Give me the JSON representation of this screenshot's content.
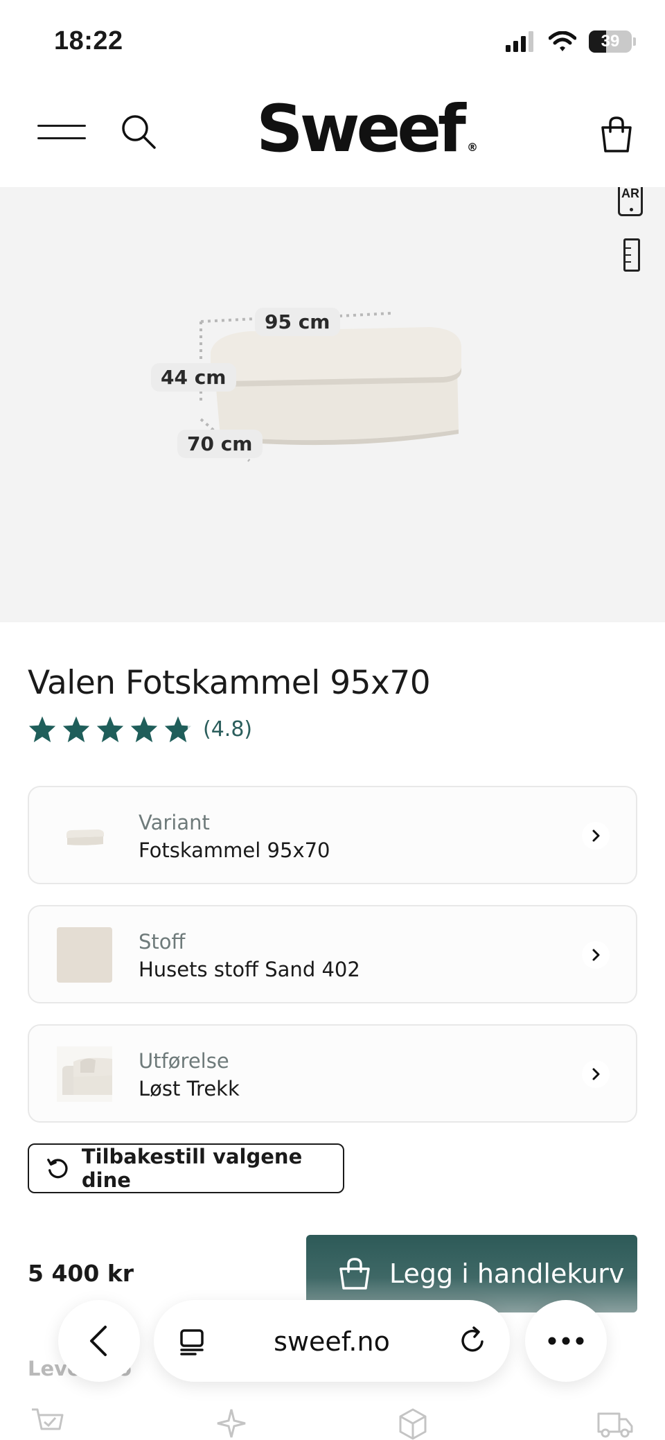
{
  "status_bar": {
    "time": "18:22",
    "battery": "39"
  },
  "header": {
    "logo": "Sweef",
    "logo_mark": "®"
  },
  "gallery": {
    "ar_label": "AR",
    "dimensions": {
      "width": "95 cm",
      "height": "44 cm",
      "depth": "70 cm"
    }
  },
  "product": {
    "title": "Valen Fotskammel 95x70",
    "rating": {
      "stars": 4.8,
      "label": "(4.8)"
    },
    "options": [
      {
        "label": "Variant",
        "value": "Fotskammel 95x70",
        "thumb": "ottoman-thumbnail"
      },
      {
        "label": "Stoff",
        "value": "Husets stoff Sand 402",
        "thumb": "fabric-swatch",
        "swatch_color": "#e4ddd3"
      },
      {
        "label": "Utførelse",
        "value": "Løst Trekk",
        "thumb": "sofa-thumbnail"
      }
    ],
    "reset_label": "Tilbakestill valgene dine",
    "price": "5 400 kr",
    "add_to_cart_label": "Legg i handlekurv",
    "delivery_info": "Leve     info"
  },
  "browser": {
    "url": "sweef.no"
  },
  "colors": {
    "accent": "#1f5e5a",
    "cta": "#2d5a58",
    "gallery_bg": "#f3f3f3"
  }
}
